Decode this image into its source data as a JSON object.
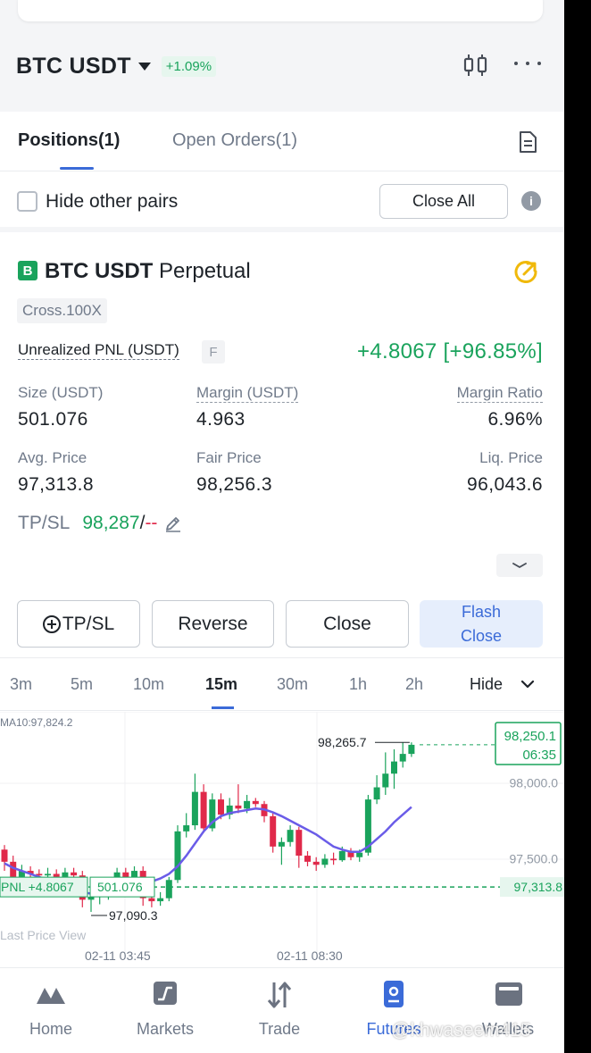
{
  "header": {
    "pair": "BTC USDT",
    "change": "+1.09%"
  },
  "tabs": [
    {
      "label": "Positions(1)",
      "active": true
    },
    {
      "label": "Open Orders(1)",
      "active": false
    }
  ],
  "filters": {
    "hide_other_pairs": "Hide other pairs",
    "close_all": "Close All"
  },
  "position": {
    "badge": "B",
    "symbol": "BTC USDT",
    "contract": "Perpetual",
    "margin_mode": "Cross.100X",
    "unrealized_pnl_label": "Unrealized PNL (USDT)",
    "f_tag": "F",
    "unrealized_pnl_value": "+4.8067 [+96.85%]",
    "size_label": "Size (USDT)",
    "size_value": "501.076",
    "margin_label": "Margin (USDT)",
    "margin_value": "4.963",
    "margin_ratio_label": "Margin Ratio",
    "margin_ratio_value": "6.96%",
    "avg_price_label": "Avg. Price",
    "avg_price_value": "97,313.8",
    "fair_price_label": "Fair Price",
    "fair_price_value": "98,256.3",
    "liq_price_label": "Liq. Price",
    "liq_price_value": "96,043.6",
    "tpsl_label": "TP/SL",
    "tp_value": "98,287",
    "tpsl_sep": "/",
    "sl_value": "--"
  },
  "actions": {
    "tpsl": "TP/SL",
    "reverse": "Reverse",
    "close": "Close",
    "flash_line1": "Flash",
    "flash_line2": "Close"
  },
  "timeframes": {
    "items": [
      "3m",
      "5m",
      "10m",
      "15m",
      "30m",
      "1h",
      "2h"
    ],
    "active": "15m",
    "hide": "Hide"
  },
  "chart_data": {
    "type": "candlestick",
    "ma_label": "MA10:97,824.2",
    "high_label": "98,265.7",
    "low_label": "97,090.3",
    "current_price": "98,250.1",
    "countdown": "06:35",
    "y_ticks": [
      "98,000.0",
      "97,500.0"
    ],
    "entry_price_label": "97,313.8",
    "pnl_tag": "PNL +4.8067",
    "size_tag": "501.076",
    "last_price_label": "Last Price View",
    "x_ticks": [
      "02-11 03:45",
      "02-11 08:30"
    ],
    "ylim": [
      96950,
      98420
    ],
    "candles": [
      {
        "o": 97560,
        "c": 97480,
        "h": 97590,
        "l": 97420
      },
      {
        "o": 97480,
        "c": 97380,
        "h": 97520,
        "l": 97330
      },
      {
        "o": 97380,
        "c": 97420,
        "h": 97460,
        "l": 97330
      },
      {
        "o": 97420,
        "c": 97400,
        "h": 97450,
        "l": 97360
      },
      {
        "o": 97400,
        "c": 97390,
        "h": 97430,
        "l": 97360
      },
      {
        "o": 97390,
        "c": 97400,
        "h": 97440,
        "l": 97350
      },
      {
        "o": 97400,
        "c": 97380,
        "h": 97430,
        "l": 97340
      },
      {
        "o": 97380,
        "c": 97410,
        "h": 97440,
        "l": 97350
      },
      {
        "o": 97410,
        "c": 97390,
        "h": 97440,
        "l": 97360
      },
      {
        "o": 97390,
        "c": 97230,
        "h": 97420,
        "l": 97180
      },
      {
        "o": 97230,
        "c": 97250,
        "h": 97290,
        "l": 97150
      },
      {
        "o": 97250,
        "c": 97260,
        "h": 97300,
        "l": 97200
      },
      {
        "o": 97260,
        "c": 97320,
        "h": 97350,
        "l": 97230
      },
      {
        "o": 97320,
        "c": 97410,
        "h": 97440,
        "l": 97300
      },
      {
        "o": 97410,
        "c": 97360,
        "h": 97440,
        "l": 97330
      },
      {
        "o": 97360,
        "c": 97420,
        "h": 97450,
        "l": 97330
      },
      {
        "o": 97420,
        "c": 97240,
        "h": 97450,
        "l": 97190
      },
      {
        "o": 97240,
        "c": 97220,
        "h": 97280,
        "l": 97180
      },
      {
        "o": 97220,
        "c": 97240,
        "h": 97280,
        "l": 97190
      },
      {
        "o": 97240,
        "c": 97360,
        "h": 97380,
        "l": 97220
      },
      {
        "o": 97360,
        "c": 97680,
        "h": 97720,
        "l": 97340
      },
      {
        "o": 97680,
        "c": 97720,
        "h": 97800,
        "l": 97640
      },
      {
        "o": 97720,
        "c": 97940,
        "h": 98060,
        "l": 97690
      },
      {
        "o": 97940,
        "c": 97700,
        "h": 97990,
        "l": 97670
      },
      {
        "o": 97700,
        "c": 97890,
        "h": 97930,
        "l": 97680
      },
      {
        "o": 97890,
        "c": 97790,
        "h": 97930,
        "l": 97760
      },
      {
        "o": 97790,
        "c": 97850,
        "h": 97900,
        "l": 97760
      },
      {
        "o": 97850,
        "c": 97830,
        "h": 97990,
        "l": 97800
      },
      {
        "o": 97830,
        "c": 97880,
        "h": 97920,
        "l": 97800
      },
      {
        "o": 97880,
        "c": 97860,
        "h": 97900,
        "l": 97840
      },
      {
        "o": 97860,
        "c": 97780,
        "h": 97880,
        "l": 97740
      },
      {
        "o": 97780,
        "c": 97580,
        "h": 97800,
        "l": 97540
      },
      {
        "o": 97580,
        "c": 97610,
        "h": 97640,
        "l": 97460
      },
      {
        "o": 97610,
        "c": 97690,
        "h": 97720,
        "l": 97580
      },
      {
        "o": 97690,
        "c": 97520,
        "h": 97710,
        "l": 97440
      },
      {
        "o": 97520,
        "c": 97480,
        "h": 97550,
        "l": 97450
      },
      {
        "o": 97480,
        "c": 97460,
        "h": 97510,
        "l": 97420
      },
      {
        "o": 97460,
        "c": 97500,
        "h": 97530,
        "l": 97440
      },
      {
        "o": 97500,
        "c": 97490,
        "h": 97540,
        "l": 97460
      },
      {
        "o": 97490,
        "c": 97550,
        "h": 97580,
        "l": 97480
      },
      {
        "o": 97550,
        "c": 97510,
        "h": 97570,
        "l": 97490
      },
      {
        "o": 97510,
        "c": 97540,
        "h": 97560,
        "l": 97480
      },
      {
        "o": 97540,
        "c": 97890,
        "h": 97920,
        "l": 97520
      },
      {
        "o": 97890,
        "c": 97970,
        "h": 98050,
        "l": 97860
      },
      {
        "o": 97970,
        "c": 98060,
        "h": 98200,
        "l": 97920
      },
      {
        "o": 98060,
        "c": 98140,
        "h": 98220,
        "l": 97960
      },
      {
        "o": 98140,
        "c": 98190,
        "h": 98265,
        "l": 98100
      },
      {
        "o": 98190,
        "c": 98250,
        "h": 98266,
        "l": 98170
      }
    ],
    "ma": [
      97470,
      97440,
      97420,
      97400,
      97380,
      97360,
      97340,
      97320,
      97300,
      97280,
      97270,
      97275,
      97290,
      97310,
      97330,
      97340,
      97345,
      97350,
      97370,
      97400,
      97450,
      97520,
      97600,
      97680,
      97740,
      97780,
      97800,
      97810,
      97820,
      97830,
      97825,
      97805,
      97780,
      97750,
      97720,
      97690,
      97660,
      97620,
      97580,
      97560,
      97545,
      97545,
      97580,
      97630,
      97680,
      97740,
      97790,
      97840
    ]
  },
  "colors": {
    "up": "#1aa35c",
    "down": "#e0294a",
    "accent": "#3b6bd8",
    "ma": "#6a5ce8"
  },
  "nav": [
    {
      "label": "Home",
      "icon": "home-icon"
    },
    {
      "label": "Markets",
      "icon": "markets-icon"
    },
    {
      "label": "Trade",
      "icon": "trade-icon"
    },
    {
      "label": "Futures",
      "icon": "futures-icon",
      "active": true
    },
    {
      "label": "Wallets",
      "icon": "wallet-icon"
    }
  ],
  "watermark": "@khwaseem415"
}
